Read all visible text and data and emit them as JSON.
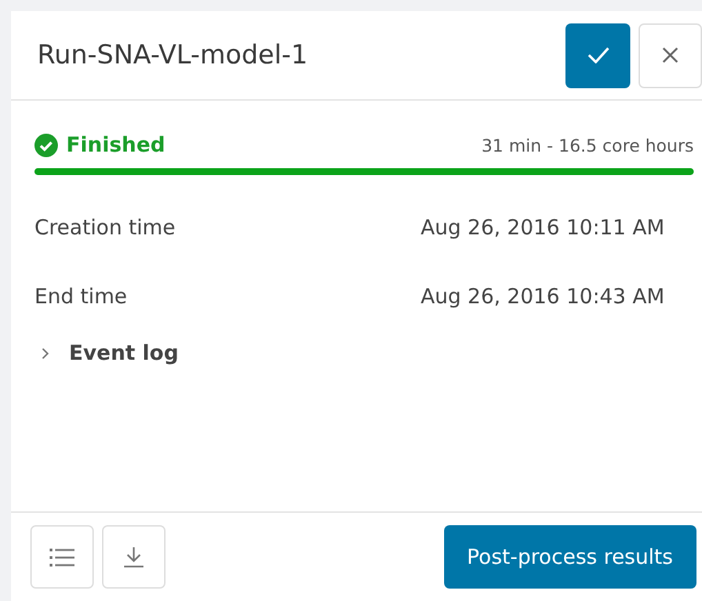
{
  "title": "Run-SNA-VL-model-1",
  "status": {
    "label": "Finished",
    "summary": "31 min - 16.5 core hours",
    "level": 1
  },
  "details": [
    {
      "label": "Creation time",
      "value": "Aug 26, 2016 10:11 AM"
    },
    {
      "label": "End time",
      "value": "Aug 26, 2016 10:43 AM"
    }
  ],
  "event_log": {
    "label": "Event log",
    "expanded": false
  },
  "footer": {
    "primary_button": "Post-process results"
  }
}
